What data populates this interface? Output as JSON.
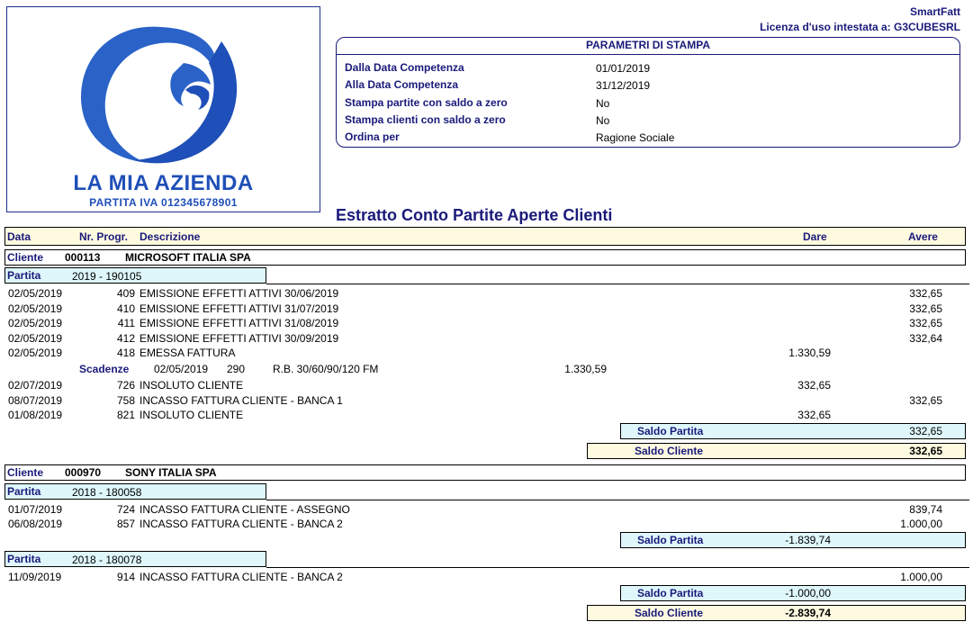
{
  "header": {
    "app_name": "SmartFatt",
    "license": "Licenza d'uso intestata a: G3CUBESRL"
  },
  "company": {
    "name": "LA MIA AZIENDA",
    "vat": "PARTITA IVA 012345678901"
  },
  "params": {
    "title": "PARAMETRI DI STAMPA",
    "rows": [
      {
        "label": "Dalla Data Competenza",
        "value": "01/01/2019"
      },
      {
        "label": "Alla Data Competenza",
        "value": "31/12/2019"
      },
      {
        "label": "Stampa partite con saldo a zero",
        "value": "No"
      },
      {
        "label": "Stampa clienti con saldo a zero",
        "value": "No"
      },
      {
        "label": "Ordina per",
        "value": "Ragione Sociale"
      }
    ]
  },
  "report_title": "Estratto Conto Partite Aperte Clienti",
  "columns": {
    "data": "Data",
    "nr": "Nr. Progr.",
    "descrizione": "Descrizione",
    "dare": "Dare",
    "avere": "Avere"
  },
  "labels": {
    "cliente": "Cliente",
    "partita": "Partita",
    "scadenze": "Scadenze",
    "saldo_partita": "Saldo Partita",
    "saldo_cliente": "Saldo Cliente"
  },
  "clients": [
    {
      "code": "000113",
      "name": "MICROSOFT ITALIA SPA",
      "partite": [
        {
          "id": "2019 - 190105",
          "movements": [
            {
              "date": "02/05/2019",
              "nr": "409",
              "desc": "EMISSIONE EFFETTI ATTIVI 30/06/2019",
              "dare": "",
              "avere": "332,65"
            },
            {
              "date": "02/05/2019",
              "nr": "410",
              "desc": "EMISSIONE EFFETTI ATTIVI 31/07/2019",
              "dare": "",
              "avere": "332,65"
            },
            {
              "date": "02/05/2019",
              "nr": "411",
              "desc": "EMISSIONE EFFETTI ATTIVI 31/08/2019",
              "dare": "",
              "avere": "332,65"
            },
            {
              "date": "02/05/2019",
              "nr": "412",
              "desc": "EMISSIONE EFFETTI ATTIVI 30/09/2019",
              "dare": "",
              "avere": "332,64"
            },
            {
              "date": "02/05/2019",
              "nr": "418",
              "desc": "EMESSA FATTURA",
              "dare": "1.330,59",
              "avere": ""
            }
          ],
          "scadenze": {
            "date": "02/05/2019",
            "nr": "290",
            "desc": "R.B. 30/60/90/120 FM",
            "amount": "1.330,59"
          },
          "movements_after": [
            {
              "date": "02/07/2019",
              "nr": "726",
              "desc": "INSOLUTO CLIENTE",
              "dare": "332,65",
              "avere": ""
            },
            {
              "date": "08/07/2019",
              "nr": "758",
              "desc": "INCASSO FATTURA CLIENTE - BANCA 1",
              "dare": "",
              "avere": "332,65"
            },
            {
              "date": "01/08/2019",
              "nr": "821",
              "desc": "INSOLUTO CLIENTE",
              "dare": "332,65",
              "avere": ""
            }
          ],
          "saldo": {
            "dare": "",
            "avere": "332,65"
          }
        }
      ],
      "saldo": {
        "dare": "",
        "avere": "332,65"
      }
    },
    {
      "code": "000970",
      "name": "SONY ITALIA SPA",
      "partite": [
        {
          "id": "2018 - 180058",
          "movements": [
            {
              "date": "01/07/2019",
              "nr": "724",
              "desc": "INCASSO FATTURA CLIENTE - ASSEGNO",
              "dare": "",
              "avere": "839,74"
            },
            {
              "date": "06/08/2019",
              "nr": "857",
              "desc": "INCASSO FATTURA CLIENTE - BANCA 2",
              "dare": "",
              "avere": "1.000,00"
            }
          ],
          "saldo": {
            "dare": "-1.839,74",
            "avere": ""
          }
        },
        {
          "id": "2018 - 180078",
          "movements": [
            {
              "date": "11/09/2019",
              "nr": "914",
              "desc": "INCASSO FATTURA CLIENTE - BANCA 2",
              "dare": "",
              "avere": "1.000,00"
            }
          ],
          "saldo": {
            "dare": "-1.000,00",
            "avere": ""
          }
        }
      ],
      "saldo": {
        "dare": "-2.839,74",
        "avere": ""
      }
    }
  ]
}
